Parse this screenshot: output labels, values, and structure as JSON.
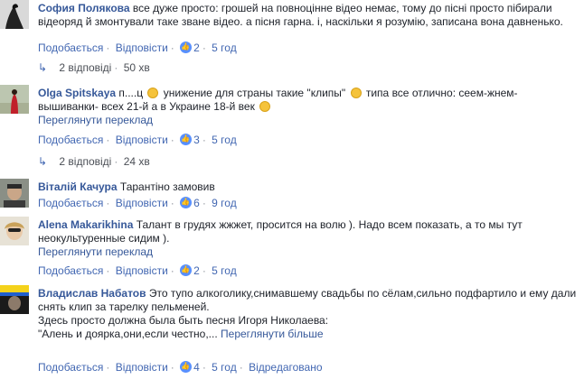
{
  "comments": [
    {
      "author": "София Полякова",
      "text": "все дуже просто: грошей на повноцінне відео немає, тому до пісні просто пібирали відеоряд й змонтували таке зване відео. а пісня гарна. і, наскільки я розумію, записана вона давненько.",
      "like_label": "Подобається",
      "reply_label": "Відповісти",
      "likes": "2",
      "time": "5 год",
      "replies_label": "2 відповіді",
      "replies_time": "50 хв"
    },
    {
      "author": "Olga Spitskaya",
      "text_a": "п....ц",
      "text_b": "унижение для страны такие \"клипы\"",
      "text_c": "типа все отлично: сеем-жнем-вышиванки-",
      "text_d": "всех 21-й а в Украине 18-й век",
      "translate_label": "Переглянути переклад",
      "like_label": "Подобається",
      "reply_label": "Відповісти",
      "likes": "3",
      "time": "5 год",
      "replies_label": "2 відповіді",
      "replies_time": "24 хв"
    },
    {
      "author": "Віталій Качура",
      "text": "Тарантіно замовив",
      "like_label": "Подобається",
      "reply_label": "Відповісти",
      "likes": "6",
      "time": "9 год"
    },
    {
      "author": "Alena Makarikhina",
      "text": "Талант в грудях жжжет, просится на волю ). Надо всем показать, а то мы тут неокультуренные сидим ).",
      "translate_label": "Переглянути переклад",
      "like_label": "Подобається",
      "reply_label": "Відповісти",
      "likes": "2",
      "time": "5 год"
    },
    {
      "author": "Владислав Набатов",
      "text": "Это тупо алкоголику,снимавшему свадьбы по сёлам,сильно подфартило и ему дали снять клип за тарелку пельменей.",
      "text2": "Здесь просто должна была быть песня Игоря Николаева:",
      "text3": "\"Алень и доярка,они,если честно,...",
      "see_more_label": "Переглянути більше",
      "like_label": "Подобається",
      "reply_label": "Відповісти",
      "likes": "4",
      "time": "5 год",
      "edited_label": "Відредаговано"
    }
  ],
  "colors": {
    "link": "#365899",
    "meta": "#90949c",
    "like_badge": "#5890ff"
  }
}
